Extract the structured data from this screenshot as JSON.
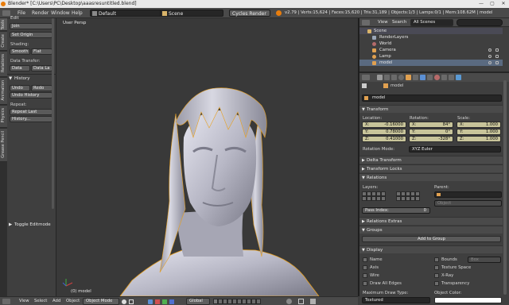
{
  "window": {
    "title": "Blender* [C:\\Users\\PC\\Desktop\\aaasresuntitled.blend]",
    "controls": [
      "—",
      "▢",
      "✕"
    ]
  },
  "info_header": {
    "menus": [
      "File",
      "Render",
      "Window",
      "Help"
    ],
    "layout": "Default",
    "scene": "Scene",
    "engine": "Cycles Render",
    "stats": "v2.79 | Verts:15,624 | Faces:15,620 | Tris:31,189 | Objects:1/3 | Lamps:0/1 | Mem:108.62M | model"
  },
  "tool_shelf": {
    "tabs": [
      "Tools",
      "Create",
      "Relations",
      "Animation",
      "Physics",
      "Grease Pencil"
    ],
    "edit_header": "Edit",
    "join": "Join",
    "set_origin": "Set Origin",
    "shading_label": "Shading:",
    "smooth": "Smooth",
    "flat": "Flat",
    "data_transfer_label": "Data Transfer:",
    "data": "Data",
    "data_layers": "Data La",
    "history_header": "History",
    "undo": "Undo",
    "redo": "Redo",
    "undo_history": "Undo History",
    "repeat_label": "Repeat:",
    "repeat_last": "Repeat Last",
    "history_btn": "History...",
    "toggle_editmode": "Toggle Editmode"
  },
  "viewport": {
    "label": "User Persp",
    "object_label": "(0) model"
  },
  "bottom_header": {
    "view": "View",
    "select": "Select",
    "add": "Add",
    "object": "Object",
    "mode": "Object Mode",
    "orientation": "Global"
  },
  "outliner": {
    "view": "View",
    "search": "Search",
    "filter": "All Scenes",
    "rows": [
      {
        "name": "Scene",
        "color": "#d9b46a"
      },
      {
        "name": "RenderLayers",
        "color": "#9aa6b8"
      },
      {
        "name": "World",
        "color": "#b36a6a"
      },
      {
        "name": "Camera",
        "color": "#e0a050"
      },
      {
        "name": "Lamp",
        "color": "#e0a050"
      },
      {
        "name": "model",
        "color": "#e0a050"
      }
    ]
  },
  "properties": {
    "object_name": "model",
    "breadcrumb": "model",
    "transform_header": "Transform",
    "location_label": "Location:",
    "rotation_label": "Rotation:",
    "scale_label": "Scale:",
    "location": {
      "x": "-0.16000",
      "y": "0.78000",
      "z": "0.41000"
    },
    "rotation": {
      "x": "84°",
      "y": "0°",
      "z": "-328°"
    },
    "scale": {
      "x": "1.000",
      "y": "1.000",
      "z": "1.000"
    },
    "rotation_mode_label": "Rotation Mode:",
    "rotation_mode": "XYZ Euler",
    "delta_transform": "Delta Transform",
    "transform_locks": "Transform Locks",
    "relations_header": "Relations",
    "layers_label": "Layers:",
    "parent_label": "Parent:",
    "parent_type": "Object",
    "pass_index": "Pass Index:",
    "pass_index_value": "0",
    "relations_extras": "Relations Extras",
    "groups_header": "Groups",
    "add_to_group": "Add to Group",
    "display_header": "Display",
    "name": "Name",
    "axis": "Axis",
    "wire": "Wire",
    "draw_all_edges": "Draw All Edges",
    "bounds": "Bounds",
    "bounds_type": "Box",
    "texture_space": "Texture Space",
    "xray": "X-Ray",
    "transparency": "Transparency",
    "max_draw_type_label": "Maximum Draw Type:",
    "max_draw_type": "Textured",
    "object_color_label": "Object Color:"
  },
  "colors": {
    "accent": "#e87d0d",
    "field_yellow": "#c8c49a",
    "selection_outline": "#e8a020"
  }
}
